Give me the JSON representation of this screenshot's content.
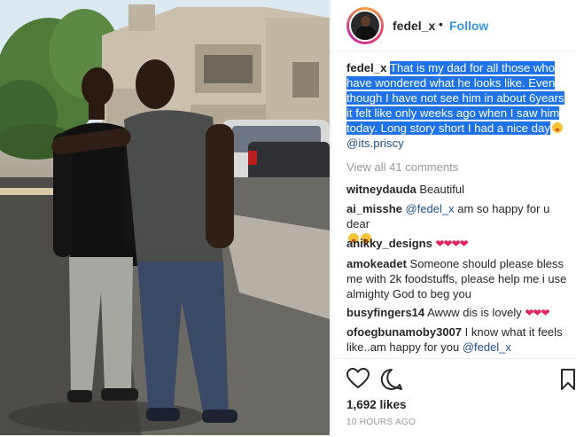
{
  "post": {
    "username": "fedel_x",
    "follow_label": "Follow",
    "separator": "•"
  },
  "caption": {
    "username": "fedel_x",
    "text": "That is my dad for all those who have wondered what he looks like. Even though I have not see him in about 6years it felt like only weeks ago when I saw him today. Long story short I had a nice day",
    "mention": "@its.priscy"
  },
  "view_all_comments": "View all 41 comments",
  "comments": [
    {
      "user": "witneydauda",
      "text": "Beautiful"
    },
    {
      "user": "ai_misshe",
      "mention": "@fedel_x",
      "text": "am so happy for u dear"
    },
    {
      "user": "anikky_designs",
      "text": ""
    },
    {
      "user": "amokeadet",
      "text": "Someone should please bless me with 2k foodstuffs, please help me i use almighty God to beg you"
    },
    {
      "user": "busyfingers14",
      "text": "Awww dis is lovely"
    },
    {
      "user": "ofoegbunamoby3007",
      "text": "I know what it feels like..am happy for you",
      "mention": "@fedel_x"
    }
  ],
  "likes": "1,692 likes",
  "timestamp": "10 HOURS AGO",
  "icons": [
    "heart-icon",
    "comment-icon",
    "bookmark-icon"
  ],
  "colors": {
    "link": "#3897f0",
    "highlight": "#1f73e6",
    "heart": "#e0245e"
  }
}
